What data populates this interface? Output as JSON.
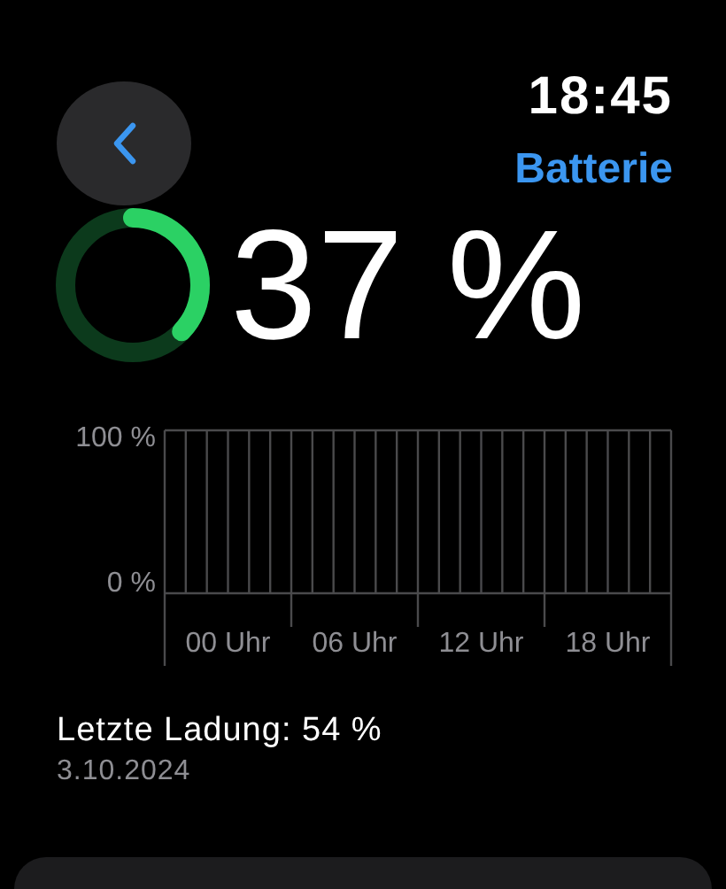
{
  "header": {
    "time": "18:45",
    "title": "Batterie"
  },
  "battery": {
    "level": 0.37,
    "percent": "37 %"
  },
  "chart": {
    "y_labels": [
      "100 %",
      "0 %"
    ],
    "x_labels": [
      "00 Uhr",
      "06 Uhr",
      "12 Uhr",
      "18 Uhr"
    ]
  },
  "last_charge": {
    "label": "Letzte Ladung: 54 %",
    "date": "3.10.2024"
  }
}
